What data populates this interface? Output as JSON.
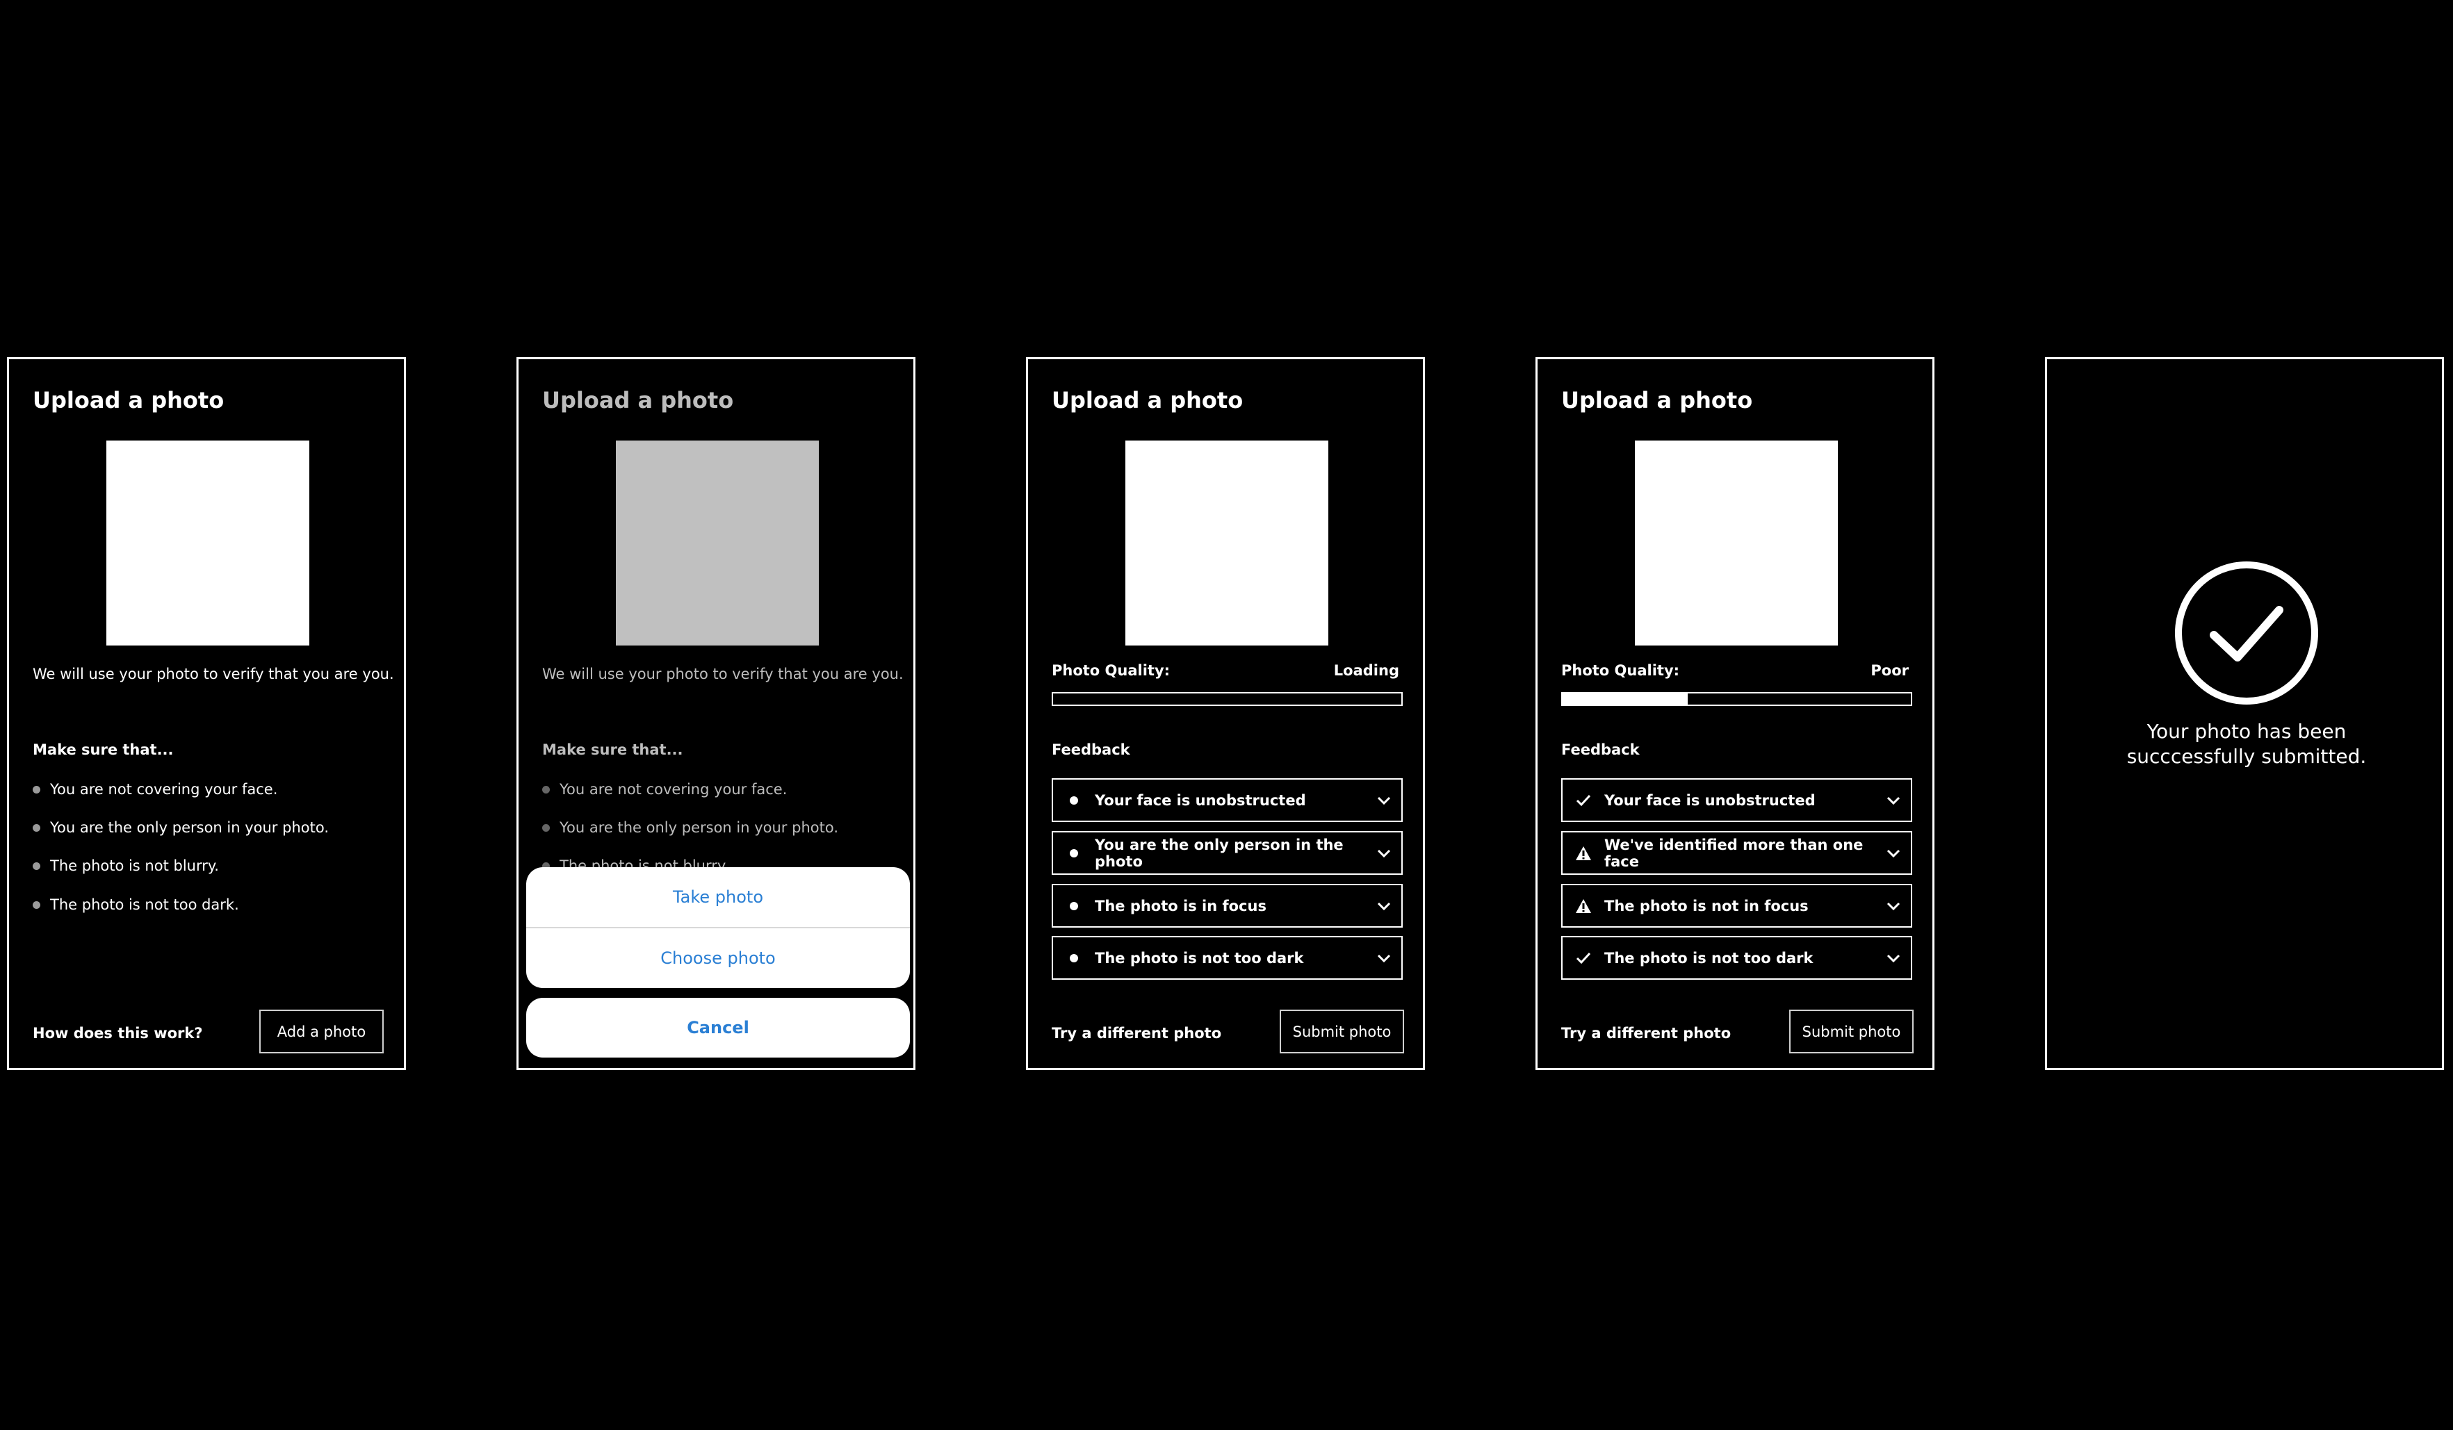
{
  "frames": {
    "f1": {
      "title": "Upload a photo",
      "intro": "We will use your photo to verify that you are you.",
      "subheading": "Make sure that...",
      "requirements": [
        "You are not covering your face.",
        "You are the only person in your photo.",
        "The photo is not blurry.",
        "The photo is not too dark."
      ],
      "link": "How does this work?",
      "button": "Add a photo"
    },
    "f2": {
      "title": "Upload a photo",
      "intro": "We will use your photo to verify that you are you.",
      "subheading": "Make sure that...",
      "requirements": [
        "You are not covering your face.",
        "You are the only person in your photo.",
        "The photo is not blurry."
      ],
      "sheet": {
        "take": "Take photo",
        "choose": "Choose photo",
        "cancel": "Cancel"
      }
    },
    "f3": {
      "title": "Upload a photo",
      "quality_label": "Photo Quality:",
      "quality_status": "Loading",
      "quality_progress": 0,
      "feedback_heading": "Feedback",
      "feedback": [
        {
          "label": "Your face is unobstructed",
          "icon": "bullet-icon"
        },
        {
          "label": "You are the only person in the photo",
          "icon": "bullet-icon"
        },
        {
          "label": "The photo is in focus",
          "icon": "bullet-icon"
        },
        {
          "label": "The photo is not too dark",
          "icon": "bullet-icon"
        }
      ],
      "link": "Try a different photo",
      "button": "Submit photo"
    },
    "f4": {
      "title": "Upload a photo",
      "quality_label": "Photo Quality:",
      "quality_status": "Poor",
      "quality_progress": 0.36,
      "feedback_heading": "Feedback",
      "feedback": [
        {
          "label": "Your face is unobstructed",
          "icon": "check-icon"
        },
        {
          "label": "We've identified more than one face",
          "icon": "warning-icon"
        },
        {
          "label": "The photo is not in focus",
          "icon": "warning-icon"
        },
        {
          "label": "The photo is not too dark",
          "icon": "check-icon"
        }
      ],
      "link": "Try a different photo",
      "button": "Submit photo"
    },
    "f5": {
      "message_line1": "Your photo has been",
      "message_line2": "succcessfully submitted."
    }
  },
  "colors": {
    "background": "#000000",
    "sheet_link": "#2a7fd4",
    "dimmed_photo": "#c0c0c0"
  }
}
